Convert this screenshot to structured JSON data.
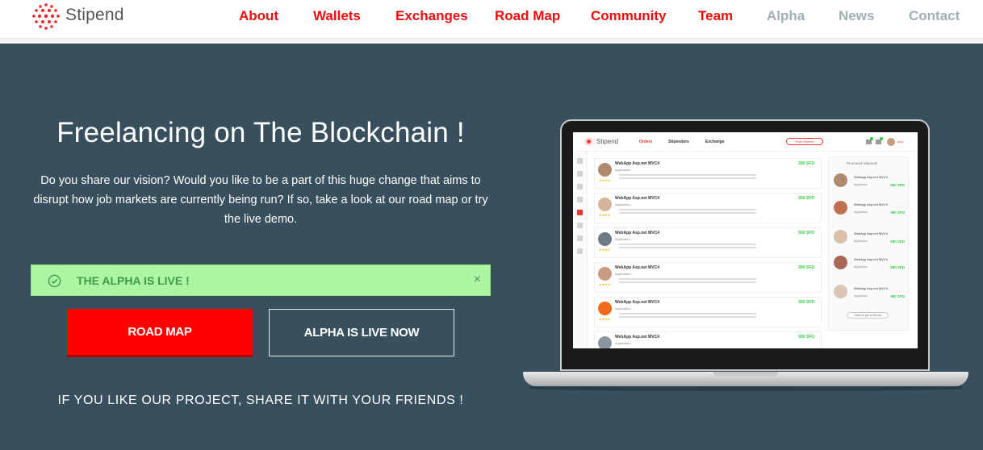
{
  "header": {
    "logo_text": "Stipend",
    "nav": [
      {
        "label": "About",
        "color": "#f20d0d"
      },
      {
        "label": "Wallets",
        "color": "#f20d0d"
      },
      {
        "label": "Exchanges",
        "color": "#f20d0d"
      },
      {
        "label": "Road Map",
        "color": "#f20d0d"
      },
      {
        "label": "Community",
        "color": "#f20d0d"
      },
      {
        "label": "Team",
        "color": "#f20d0d"
      },
      {
        "label": "Alpha",
        "color": "#9fb0b6"
      },
      {
        "label": "News",
        "color": "#9fb0b6"
      },
      {
        "label": "Contact",
        "color": "#9fb0b6"
      }
    ]
  },
  "hero": {
    "title": "Freelancing on The Blockchain !",
    "description": "Do you share our vision? Would you like to be a part of this huge change that aims to disrupt how job markets are currently being run? If so, take a look at our road map or try the live demo.",
    "alert_text": "THE ALPHA IS LIVE !",
    "alert_close": "×",
    "btn_roadmap": "ROAD MAP",
    "btn_alpha": "ALPHA IS LIVE NOW",
    "share_text": "IF YOU LIKE OUR PROJECT, SHARE IT WITH YOUR FRIENDS !"
  },
  "mini_app": {
    "logo_text": "Stipend",
    "nav_orders": "Orders",
    "nav_stipenders": "Stipenders",
    "nav_exchange": "Exchange",
    "post_button": "Post Stipend",
    "jobs": [
      {
        "title": "WebApp Asp.net MVC4",
        "sub": "Application",
        "price": "590 SFD"
      },
      {
        "title": "WebApp Asp.net MVC4",
        "sub": "Application",
        "price": "590 SFD"
      },
      {
        "title": "WebApp Asp.net MVC4",
        "sub": "Application",
        "price": "590 SFD"
      },
      {
        "title": "WebApp Asp.net MVC4",
        "sub": "Application",
        "price": "590 SFD"
      },
      {
        "title": "WebApp Asp.net MVC4",
        "sub": "Application",
        "price": "590 SFD"
      },
      {
        "title": "WebApp Asp.net MVC4",
        "sub": "Application",
        "price": "590 SFD"
      }
    ],
    "panel_title": "Promoted Stipends",
    "panel_items": [
      {
        "title": "WebApp Asp.net MVC4",
        "sub": "Application",
        "price": "590 SFD"
      },
      {
        "title": "WebApp Asp.net MVC4",
        "sub": "Application",
        "price": "590 SFD"
      },
      {
        "title": "WebApp Asp.net MVC4",
        "sub": "Application",
        "price": "590 SFD"
      },
      {
        "title": "WebApp Asp.net MVC4",
        "sub": "Application",
        "price": "590 SFD"
      },
      {
        "title": "WebApp Asp.net MVC4",
        "sub": "Application",
        "price": "590 SFD"
      }
    ],
    "panel_button": "I want to get to the top"
  },
  "colors": {
    "hero_bg": "#38505e",
    "accent_red": "#ff0000",
    "alert_bg": "#abf5a3",
    "alert_text": "#3f9a4b"
  }
}
